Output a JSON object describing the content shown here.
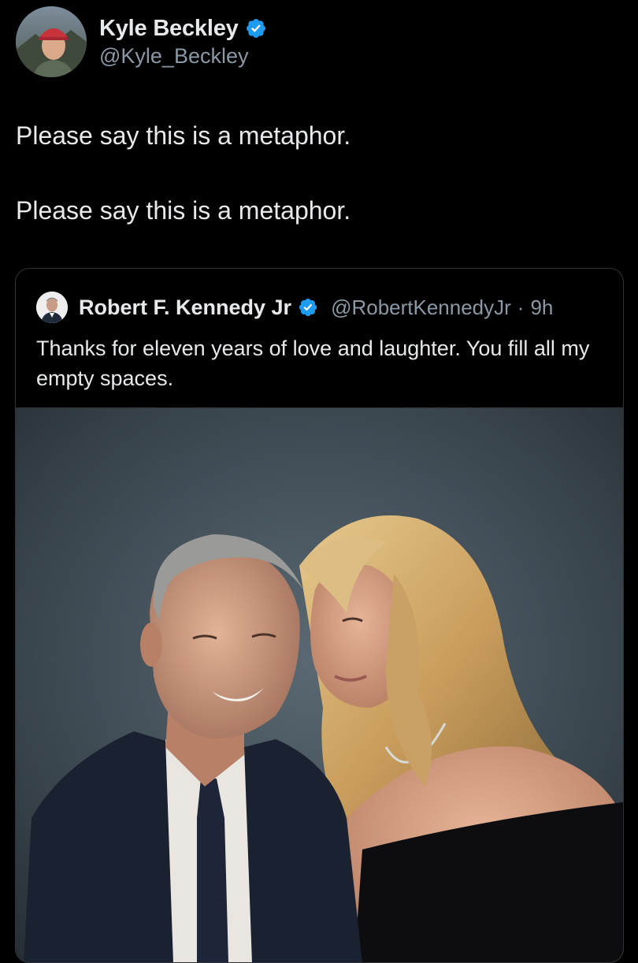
{
  "author": {
    "display_name": "Kyle Beckley",
    "handle": "@Kyle_Beckley",
    "verified_icon": "verified-badge-icon"
  },
  "tweet": {
    "lines": [
      "Please say this is a metaphor.",
      "Please say this is a metaphor."
    ]
  },
  "quoted": {
    "display_name": "Robert F. Kennedy Jr",
    "handle": "@RobertKennedyJr",
    "separator": "·",
    "time": "9h",
    "text": "Thanks for eleven years of love and laughter. You fill all my empty spaces.",
    "verified_icon": "verified-badge-icon",
    "media": "photo"
  },
  "colors": {
    "background": "#000000",
    "text": "#e7e9ea",
    "secondary_text": "#8b98a5",
    "verified_blue": "#1d9bf0",
    "card_border": "#2f3336"
  }
}
